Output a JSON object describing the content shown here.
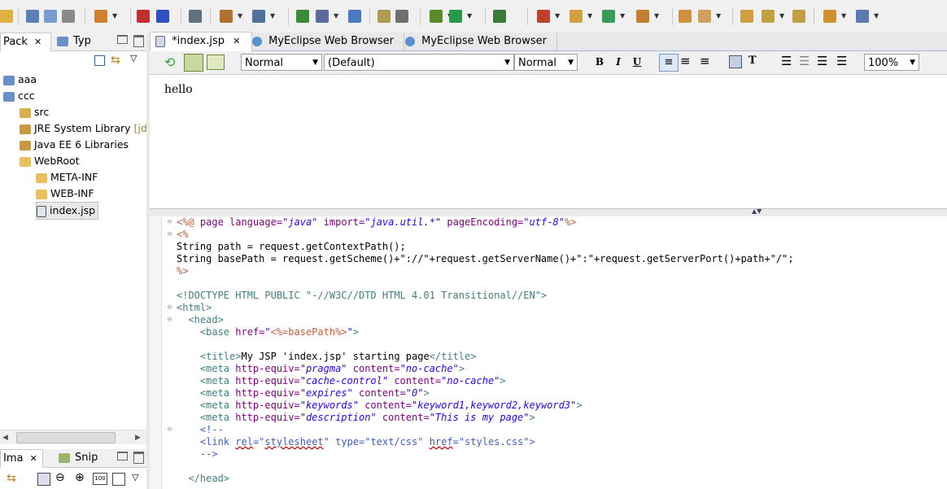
{
  "main_toolbar": {
    "icons": [
      "new-icon",
      "save-icon",
      "save-all-icon",
      "print-icon",
      "new-wizard-icon",
      "package-icon",
      "class-icon",
      "open-type-icon",
      "run-ant-icon",
      "search-icon",
      "deploy-icon",
      "server-icon",
      "browser-icon",
      "open-perspective-icon",
      "camera-icon",
      "debug-icon",
      "run-icon",
      "coverage-icon",
      "external-tools-icon",
      "add-icon",
      "refresh-icon",
      "team-icon",
      "pen-icon",
      "folder-icon",
      "next-annotation-icon",
      "previous-annotation-icon",
      "last-edit-icon",
      "back-icon",
      "forward-icon"
    ]
  },
  "package_explorer": {
    "tabs": [
      {
        "label": "Pack",
        "active": true
      },
      {
        "label": "Typ",
        "active": false
      }
    ],
    "tree": [
      {
        "label": "aaa",
        "icon": "project-icon",
        "depth": 0
      },
      {
        "label": "ccc",
        "icon": "project-icon",
        "depth": 0
      },
      {
        "label": "src",
        "icon": "source-folder-icon",
        "depth": 1
      },
      {
        "label": "JRE System Library",
        "suffix": "[jdk",
        "icon": "library-icon",
        "depth": 1
      },
      {
        "label": "Java EE 6 Libraries",
        "icon": "library-icon",
        "depth": 1
      },
      {
        "label": "WebRoot",
        "icon": "folder-icon",
        "depth": 1
      },
      {
        "label": "META-INF",
        "icon": "folder-icon",
        "depth": 2
      },
      {
        "label": "WEB-INF",
        "icon": "folder-icon",
        "depth": 2
      },
      {
        "label": "index.jsp",
        "icon": "jsp-file-icon",
        "depth": 2,
        "selected": true
      }
    ]
  },
  "bottom_panel": {
    "tabs": [
      {
        "label": "Ima",
        "active": true
      },
      {
        "label": "Snip",
        "active": false
      }
    ]
  },
  "editor": {
    "tabs": [
      {
        "label": "*index.jsp",
        "active": true,
        "icon": "jsp-file-icon"
      },
      {
        "label": "MyEclipse Web Browser",
        "active": false,
        "icon": "globe-icon"
      },
      {
        "label": "MyEclipse Web Browser",
        "active": false,
        "icon": "globe-icon"
      }
    ],
    "format_toolbar": {
      "paragraph_style": "Normal",
      "font": "(Default)",
      "size": "Normal",
      "bold": "B",
      "italic": "I",
      "underline": "U",
      "zoom": "100%"
    },
    "design_text": "hello",
    "source_lines": [
      [
        [
          "jsp",
          "<%@ "
        ],
        [
          "attr",
          "page "
        ],
        [
          "attr",
          "language="
        ],
        [
          "val",
          "\"java\""
        ],
        [
          "attr",
          " import="
        ],
        [
          "val",
          "\"java.util.*\""
        ],
        [
          "attr",
          " pageEncoding="
        ],
        [
          "val",
          "\"utf-8\""
        ],
        [
          "jsp",
          "%>"
        ]
      ],
      [
        [
          "jsp",
          "<%"
        ]
      ],
      [
        [
          "text",
          "String path = request.getContextPath();"
        ]
      ],
      [
        [
          "text",
          "String basePath = request.getScheme()+\"://\"+request.getServerName()+\":\"+request.getServerPort()+path+\"/\";"
        ]
      ],
      [
        [
          "jsp",
          "%>"
        ]
      ],
      [],
      [
        [
          "doc",
          "<!DOCTYPE HTML PUBLIC \"-//W3C//DTD HTML 4.01 Transitional//EN\">"
        ]
      ],
      [
        [
          "tag",
          "<html>"
        ]
      ],
      [
        [
          "tag",
          "  <head>"
        ]
      ],
      [
        [
          "tag",
          "    <base "
        ],
        [
          "attr",
          "href="
        ],
        [
          "val2",
          "\""
        ],
        [
          "jsp",
          "<%=basePath%>"
        ],
        [
          "val2",
          "\""
        ],
        [
          "tag",
          ">"
        ]
      ],
      [],
      [
        [
          "tag",
          "    <title>"
        ],
        [
          "text",
          "My JSP 'index.jsp' starting page"
        ],
        [
          "tag",
          "</title>"
        ]
      ],
      [
        [
          "tag",
          "    <meta "
        ],
        [
          "attr",
          "http-equiv="
        ],
        [
          "val",
          "\"pragma\""
        ],
        [
          "attr",
          " content="
        ],
        [
          "val",
          "\"no-cache\""
        ],
        [
          "tag",
          ">"
        ]
      ],
      [
        [
          "tag",
          "    <meta "
        ],
        [
          "attr",
          "http-equiv="
        ],
        [
          "val",
          "\"cache-control\""
        ],
        [
          "attr",
          " content="
        ],
        [
          "val",
          "\"no-cache\""
        ],
        [
          "tag",
          ">"
        ]
      ],
      [
        [
          "tag",
          "    <meta "
        ],
        [
          "attr",
          "http-equiv="
        ],
        [
          "val",
          "\"expires\""
        ],
        [
          "attr",
          " content="
        ],
        [
          "val",
          "\"0\""
        ],
        [
          "tag",
          ">"
        ]
      ],
      [
        [
          "tag",
          "    <meta "
        ],
        [
          "attr",
          "http-equiv="
        ],
        [
          "val",
          "\"keywords\""
        ],
        [
          "attr",
          " content="
        ],
        [
          "val",
          "\"keyword1,keyword2,keyword3\""
        ],
        [
          "tag",
          ">"
        ]
      ],
      [
        [
          "tag",
          "    <meta "
        ],
        [
          "attr",
          "http-equiv="
        ],
        [
          "val",
          "\"description\""
        ],
        [
          "attr",
          " content="
        ],
        [
          "val",
          "\"This is my page\""
        ],
        [
          "tag",
          ">"
        ]
      ],
      [
        [
          "cmt",
          "    <!--"
        ]
      ],
      [
        [
          "cmt",
          "    <link "
        ],
        [
          "cmtsq",
          "rel"
        ],
        [
          "cmt",
          "=\""
        ],
        [
          "cmtsq",
          "stylesheet"
        ],
        [
          "cmt",
          "\" type=\"text/css\" "
        ],
        [
          "cmtsq",
          "href"
        ],
        [
          "cmt",
          "=\"styles.css\">"
        ]
      ],
      [
        [
          "cmt",
          "    -->"
        ]
      ],
      [],
      [
        [
          "tag",
          "  </head>"
        ]
      ]
    ],
    "fold_markers": [
      0,
      1,
      7,
      8,
      17
    ]
  },
  "colors": {
    "jsp_delim": "#bf5f3f",
    "tag": "#3f7f7f",
    "attr": "#7f007f",
    "value": "#2a00ff",
    "comment": "#3f5fbf"
  }
}
